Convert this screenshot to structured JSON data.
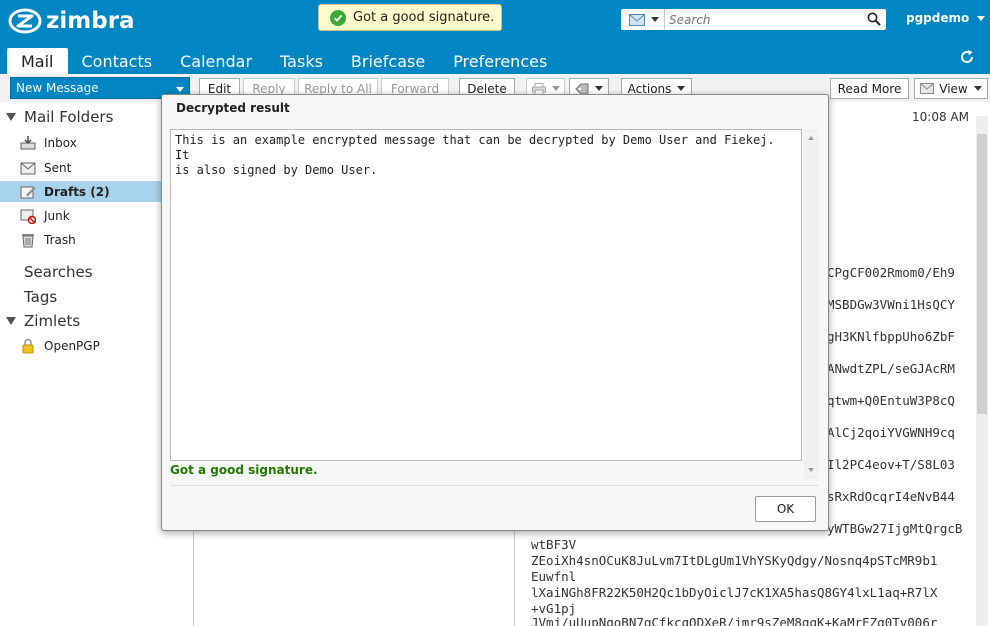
{
  "app": {
    "brand": "zimbra",
    "user": "pgpdemo"
  },
  "toast": {
    "text": "Got a good signature."
  },
  "search": {
    "placeholder": "Search"
  },
  "tabs": [
    {
      "label": "Mail",
      "active": true
    },
    {
      "label": "Contacts"
    },
    {
      "label": "Calendar"
    },
    {
      "label": "Tasks"
    },
    {
      "label": "Briefcase"
    },
    {
      "label": "Preferences"
    }
  ],
  "toolbar": {
    "new_message": "New Message",
    "edit": "Edit",
    "reply": "Reply",
    "reply_all": "Reply to All",
    "forward": "Forward",
    "delete": "Delete",
    "actions": "Actions",
    "read_more": "Read More",
    "view": "View"
  },
  "sidebar": {
    "mail_folders": "Mail Folders",
    "folders": [
      {
        "label": "Inbox",
        "icon": "inbox-icon"
      },
      {
        "label": "Sent",
        "icon": "sent-icon"
      },
      {
        "label": "Drafts (2)",
        "icon": "drafts-icon",
        "selected": true
      },
      {
        "label": "Junk",
        "icon": "junk-icon"
      },
      {
        "label": "Trash",
        "icon": "trash-icon"
      }
    ],
    "searches": "Searches",
    "tags": "Tags",
    "zimlets": "Zimlets",
    "zimlet_items": [
      {
        "label": "OpenPGP",
        "icon": "lock-icon"
      }
    ]
  },
  "reading": {
    "time": "10:08 AM",
    "pgp_tails": [
      "CPgCF002Rmom0/Eh9",
      "MSBDGw3VWni1HsQCY",
      "gH3KNlfbppUho6ZbF",
      "ANwdtZPL/seGJAcRM",
      "qtwm+Q0EntuW3P8cQ",
      "AlCj2qoiYVGWNH9cq",
      "Il2PC4eov+T/S8L03",
      "sRxRdOcqrI4eNvB44",
      "yWTBGw27IjgMtQrgcB"
    ],
    "pgp_lines": [
      "wtBF3V",
      "ZEoiXh4snOCuK8JuLvm7ItDLgUm1VhYSKyQdgy/Nosnq4pSTcMR9b1",
      "Euwfnl",
      "lXaiNGh8FR22K50H2Qc1bDyOiclJ7cK1XA5hasQ8GY4lxL1aq+R7lX",
      "+vG1pj",
      "JVmj/uUupNqoBN7qCfkcqODXeR/jmr9sZeM8qqK+KaMrEZq0Tv006r"
    ]
  },
  "dialog": {
    "title": "Decrypted result",
    "body": "This is an example encrypted message that can be decrypted by Demo User and Fiekej. It\nis also signed by Demo User.",
    "signature_status": "Got a good signature.",
    "ok": "OK"
  },
  "colors": {
    "brand_blue": "#0087c3",
    "selected_folder": "#a9d3ed",
    "signature_green": "#217a00",
    "toast_bg": "#fffbcc"
  }
}
